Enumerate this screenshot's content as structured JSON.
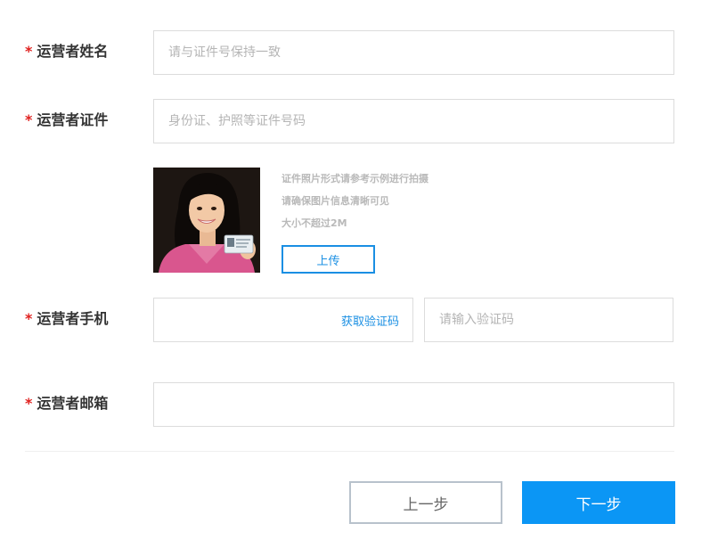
{
  "form": {
    "name": {
      "label": "运营者姓名",
      "required_mark": "*",
      "placeholder": "请与证件号保持一致"
    },
    "id_card": {
      "label": "运营者证件",
      "required_mark": "*",
      "placeholder": "身份证、护照等证件号码"
    },
    "photo": {
      "hints": [
        "证件照片形式请参考示例进行拍摄",
        "请确保图片信息清晰可见",
        "大小不超过2M"
      ],
      "upload_label": "上传"
    },
    "phone": {
      "label": "运营者手机",
      "required_mark": "*",
      "get_code_label": "获取验证码",
      "code_placeholder": "请输入验证码"
    },
    "email": {
      "label": "运营者邮箱",
      "required_mark": "*",
      "placeholder": ""
    }
  },
  "footer": {
    "prev_label": "上一步",
    "next_label": "下一步"
  },
  "colors": {
    "accent": "#1a8fe3",
    "primary_button": "#0b96f5",
    "required": "#e0211f"
  }
}
